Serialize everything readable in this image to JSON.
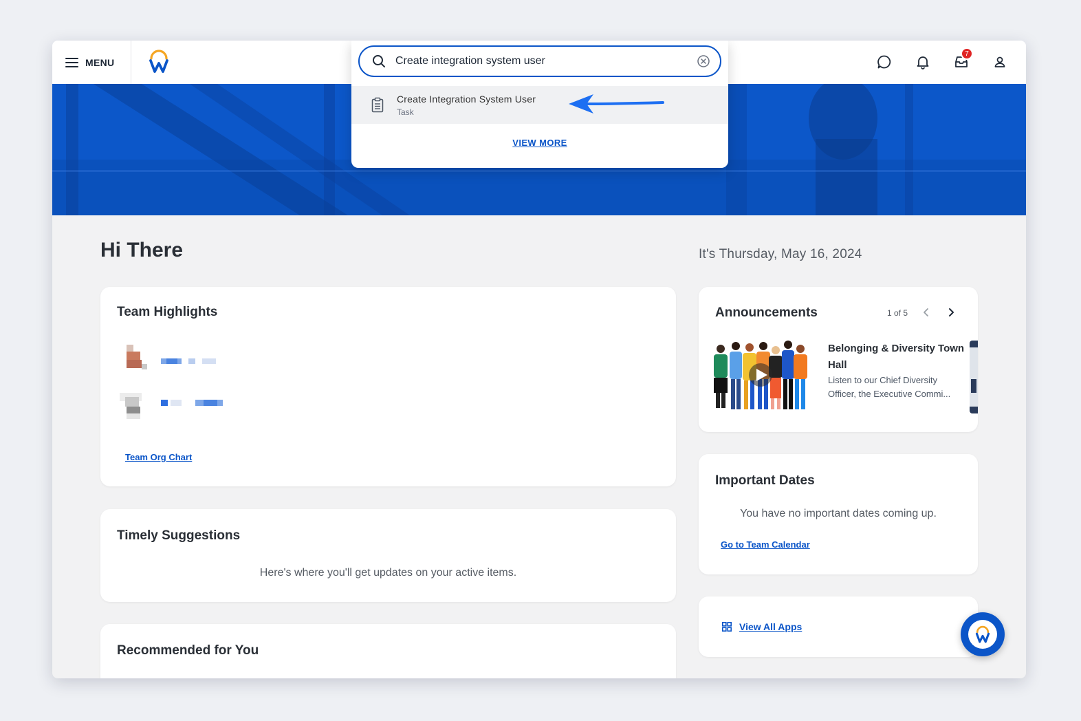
{
  "header": {
    "menu_label": "MENU",
    "inbox_count": "7"
  },
  "search": {
    "value": "Create integration system user",
    "results": [
      {
        "title": "Create Integration System User",
        "type": "Task"
      }
    ],
    "view_more_label": "VIEW MORE"
  },
  "main": {
    "greeting": "Hi There",
    "date": "It's Thursday, May 16, 2024"
  },
  "team_highlights": {
    "title": "Team Highlights",
    "org_chart_link": "Team Org Chart"
  },
  "timely_suggestions": {
    "title": "Timely Suggestions",
    "empty_text": "Here's where you'll get updates on your active items."
  },
  "recommended": {
    "title": "Recommended for You"
  },
  "announcements": {
    "title": "Announcements",
    "pager": "1 of 5",
    "item_title": "Belonging & Diversity Town Hall",
    "item_desc": "Listen to our Chief Diversity Officer, the Executive Commi..."
  },
  "important_dates": {
    "title": "Important Dates",
    "empty_text": "You have no important dates coming up.",
    "calendar_link": "Go to Team Calendar"
  },
  "apps": {
    "view_all_label": "View All Apps"
  },
  "colors": {
    "brand_blue": "#0b55c8",
    "logo_orange": "#f5a623",
    "badge_red": "#e02424"
  }
}
